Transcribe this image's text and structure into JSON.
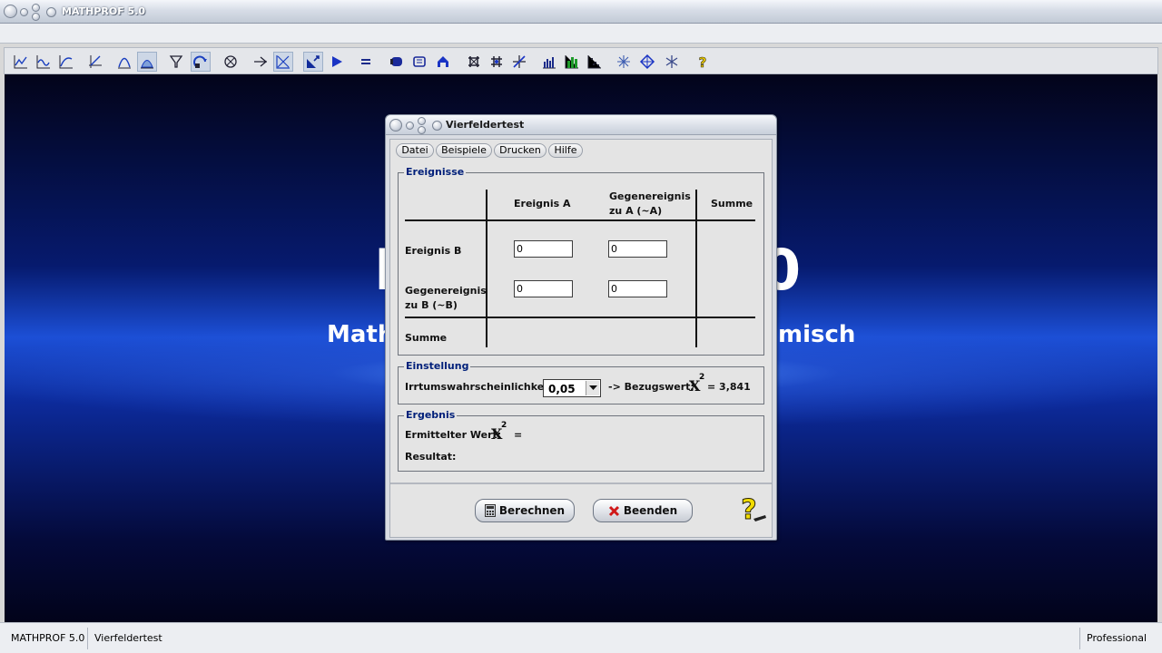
{
  "app": {
    "title": "MATHPROF 5.0"
  },
  "toolbar": {
    "icons": [
      "graph-icon",
      "multi-graph-icon",
      "curve-icon",
      "axes-icon",
      "parabola-icon",
      "area-icon",
      "funnel-icon",
      "rotate-icon",
      "circle-x-icon",
      "arrow-cross-icon",
      "grid-icon",
      "vector-icon",
      "play-icon",
      "equals-icon",
      "blob-icon",
      "layers-icon",
      "arch-icon",
      "star-icon",
      "net-icon",
      "cross-icon",
      "bar-chart-icon",
      "green-bar-chart-icon",
      "scatter-icon",
      "asterisk-icon",
      "diamond-icon",
      "snowflake-icon",
      "help-icon"
    ]
  },
  "splash": {
    "big_left": "M",
    "big_right": "0",
    "sub_left": "Math",
    "sub_right": "misch"
  },
  "dialog": {
    "title": "Vierfeldertest",
    "menu": [
      "Datei",
      "Beispiele",
      "Drucken",
      "Hilfe"
    ],
    "events": {
      "group_title": "Ereignisse",
      "col_a": "Ereignis A",
      "col_not_a_line1": "Gegenereignis",
      "col_not_a_line2": "zu A (~A)",
      "col_sum": "Summe",
      "row_b": "Ereignis B",
      "row_not_b_line1": "Gegenereignis",
      "row_not_b_line2": "zu B (~B)",
      "row_sum": "Summe",
      "cells": {
        "b_a": "0",
        "b_not_a": "0",
        "not_b_a": "0",
        "not_b_not_a": "0"
      }
    },
    "settings": {
      "group_title": "Einstellung",
      "error_label": "Irrtumswahrscheinlichkeit:",
      "error_value": "0,05",
      "reference_label": "-> Bezugswert:",
      "chi_symbol": "X",
      "chi_exp": "2",
      "reference_eq": "= 3,841"
    },
    "result": {
      "group_title": "Ergebnis",
      "value_label": "Ermittelter Wert:",
      "chi_symbol": "X",
      "chi_exp": "2",
      "value_eq": "=",
      "result_label": "Resultat:"
    },
    "buttons": {
      "calculate": "Berechnen",
      "quit": "Beenden"
    }
  },
  "statusbar": {
    "app": "MATHPROF 5.0",
    "module": "Vierfeldertest",
    "edition": "Professional"
  },
  "colors": {
    "group_title": "#00207a",
    "background_blue": "#1c4fd6"
  }
}
